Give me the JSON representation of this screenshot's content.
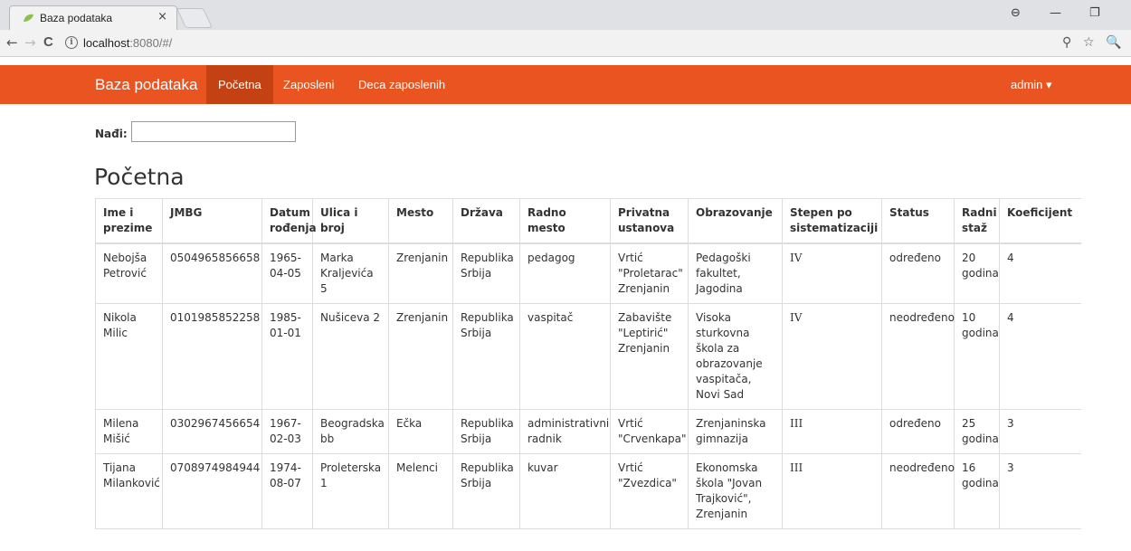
{
  "browser": {
    "tab_title": "Baza podataka",
    "tab_close": "×",
    "url_host": "localhost",
    "url_rest": ":8080/#/",
    "info_icon": "i",
    "back": "←",
    "forward": "→",
    "reload": "C",
    "profile_icon": "⊖",
    "minimize": "—",
    "restore": "❐",
    "key_icon": "⚲",
    "star_icon": "☆",
    "ext_icon": "🔍"
  },
  "navbar": {
    "brand": "Baza podataka",
    "links": [
      "Početna",
      "Zaposleni",
      "Deca zaposlenih"
    ],
    "active_index": 0,
    "user": "admin ▾",
    "color": "#e95420",
    "active_color": "#c34113"
  },
  "search": {
    "label": "Nađi:",
    "value": ""
  },
  "page_title": "Početna",
  "table": {
    "headers": [
      "Ime i prezime",
      "JMBG",
      "Datum rođenja",
      "Ulica i broj",
      "Mesto",
      "Država",
      "Radno mesto",
      "Privatna ustanova",
      "Obrazovanje",
      "Stepen po sistematizaciji",
      "Status",
      "Radni staž",
      "Koeficijent"
    ],
    "rows": [
      [
        "Nebojša Petrović",
        "0504965856658",
        "1965-04-05",
        "Marka Kraljevića 5",
        "Zrenjanin",
        "Republika Srbija",
        "pedagog",
        "Vrtić \"Proletarac\" Zrenjanin",
        "Pedagoški fakultet, Jagodina",
        "IV",
        "određeno",
        "20 godina",
        "4"
      ],
      [
        "Nikola Milic",
        "0101985852258",
        "1985-01-01",
        "Nušiceva 2",
        "Zrenjanin",
        "Republika Srbija",
        "vaspitač",
        "Zabavište \"Leptirić\" Zrenjanin",
        "Visoka sturkovna škola za obrazovanje vaspitača, Novi Sad",
        "IV",
        "neodređeno",
        "10 godina",
        "4"
      ],
      [
        "Milena Mišić",
        "0302967456654",
        "1967-02-03",
        "Beogradska bb",
        "Ečka",
        "Republika Srbija",
        "administrativni radnik",
        "Vrtić \"Crvenkapa\"",
        "Zrenjaninska gimnazija",
        "III",
        "određeno",
        "25 godina",
        "3"
      ],
      [
        "Tijana Milanković",
        "0708974984944",
        "1974-08-07",
        "Proleterska 1",
        "Melenci",
        "Republika Srbija",
        "kuvar",
        "Vrtić \"Zvezdica\"",
        "Ekonomska škola \"Jovan Trajković\", Zrenjanin",
        "III",
        "neodređeno",
        "16 godina",
        "3"
      ]
    ]
  }
}
